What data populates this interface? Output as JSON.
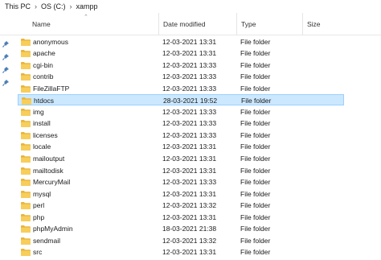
{
  "breadcrumb": {
    "items": [
      "This PC",
      "OS (C:)",
      "xampp"
    ]
  },
  "columns": {
    "name": "Name",
    "date": "Date modified",
    "type": "Type",
    "size": "Size"
  },
  "selected_index": 5,
  "rows": [
    {
      "name": "anonymous",
      "date": "12-03-2021 13:31",
      "type": "File folder"
    },
    {
      "name": "apache",
      "date": "12-03-2021 13:31",
      "type": "File folder"
    },
    {
      "name": "cgi-bin",
      "date": "12-03-2021 13:33",
      "type": "File folder"
    },
    {
      "name": "contrib",
      "date": "12-03-2021 13:33",
      "type": "File folder"
    },
    {
      "name": "FileZillaFTP",
      "date": "12-03-2021 13:33",
      "type": "File folder"
    },
    {
      "name": "htdocs",
      "date": "28-03-2021 19:52",
      "type": "File folder"
    },
    {
      "name": "img",
      "date": "12-03-2021 13:33",
      "type": "File folder"
    },
    {
      "name": "install",
      "date": "12-03-2021 13:33",
      "type": "File folder"
    },
    {
      "name": "licenses",
      "date": "12-03-2021 13:33",
      "type": "File folder"
    },
    {
      "name": "locale",
      "date": "12-03-2021 13:31",
      "type": "File folder"
    },
    {
      "name": "mailoutput",
      "date": "12-03-2021 13:31",
      "type": "File folder"
    },
    {
      "name": "mailtodisk",
      "date": "12-03-2021 13:31",
      "type": "File folder"
    },
    {
      "name": "MercuryMail",
      "date": "12-03-2021 13:33",
      "type": "File folder"
    },
    {
      "name": "mysql",
      "date": "12-03-2021 13:31",
      "type": "File folder"
    },
    {
      "name": "perl",
      "date": "12-03-2021 13:32",
      "type": "File folder"
    },
    {
      "name": "php",
      "date": "12-03-2021 13:31",
      "type": "File folder"
    },
    {
      "name": "phpMyAdmin",
      "date": "18-03-2021 21:38",
      "type": "File folder"
    },
    {
      "name": "sendmail",
      "date": "12-03-2021 13:32",
      "type": "File folder"
    },
    {
      "name": "src",
      "date": "12-03-2021 13:31",
      "type": "File folder"
    }
  ]
}
